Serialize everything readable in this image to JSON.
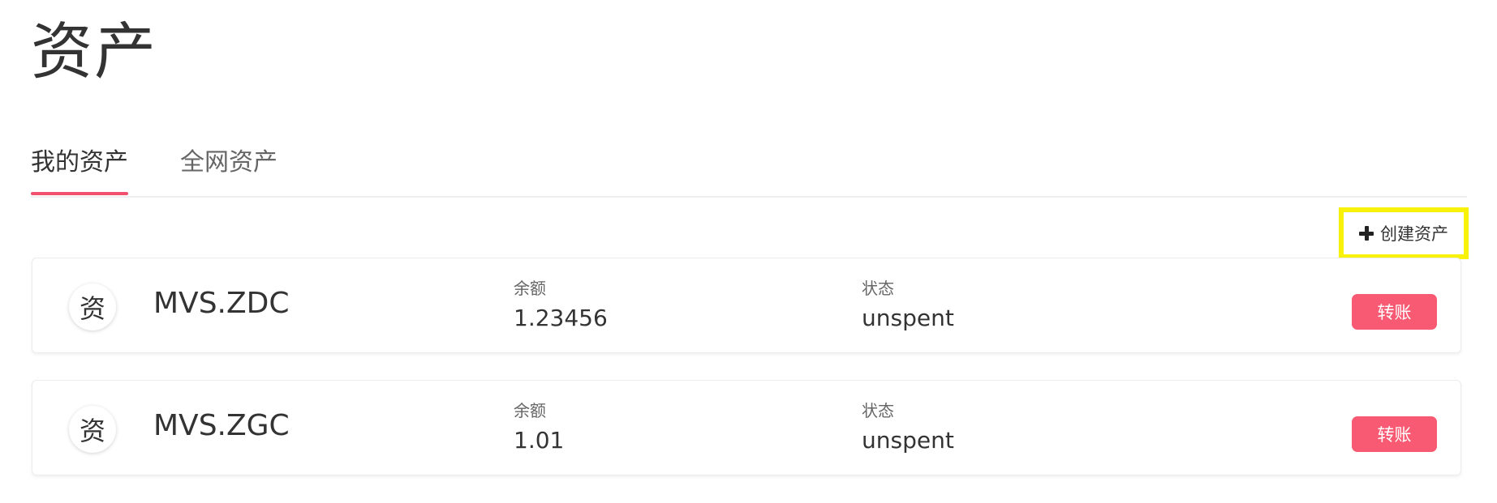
{
  "page": {
    "title": "资产"
  },
  "tabs": [
    {
      "label": "我的资产",
      "active": true
    },
    {
      "label": "全网资产",
      "active": false
    }
  ],
  "actions": {
    "create_asset_label": "创建资产",
    "create_asset_icon": "plus-icon"
  },
  "assets": [
    {
      "avatar_text": "资",
      "name": "MVS.ZDC",
      "balance_label": "余额",
      "balance": "1.23456",
      "status_label": "状态",
      "status": "unspent",
      "transfer_label": "转账"
    },
    {
      "avatar_text": "资",
      "name": "MVS.ZGC",
      "balance_label": "余额",
      "balance": "1.01",
      "status_label": "状态",
      "status": "unspent",
      "transfer_label": "转账"
    }
  ],
  "colors": {
    "accent": "#f2506e",
    "button": "#f75a72",
    "highlight_border": "#f8f20a"
  }
}
